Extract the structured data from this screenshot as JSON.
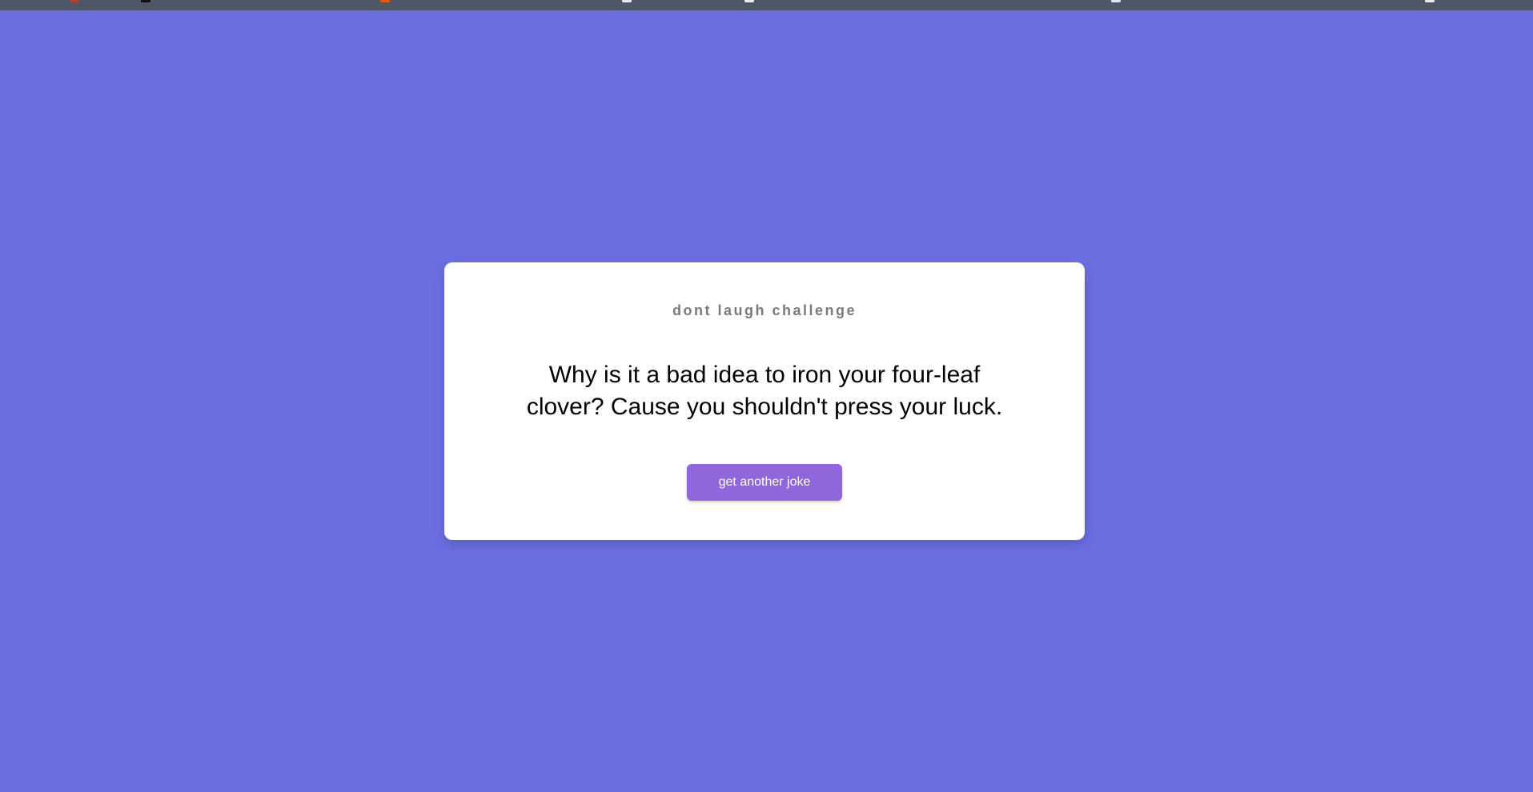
{
  "colors": {
    "background": "#6b6ee0",
    "card": "#ffffff",
    "button": "#9066dc",
    "title": "#7a7a7a",
    "browser_strip": "#4f5668"
  },
  "card": {
    "title": "dont laugh challenge",
    "joke": "Why is it a bad idea to iron your four-leaf clover? Cause you shouldn't press your luck.",
    "button_label": "get another joke"
  }
}
